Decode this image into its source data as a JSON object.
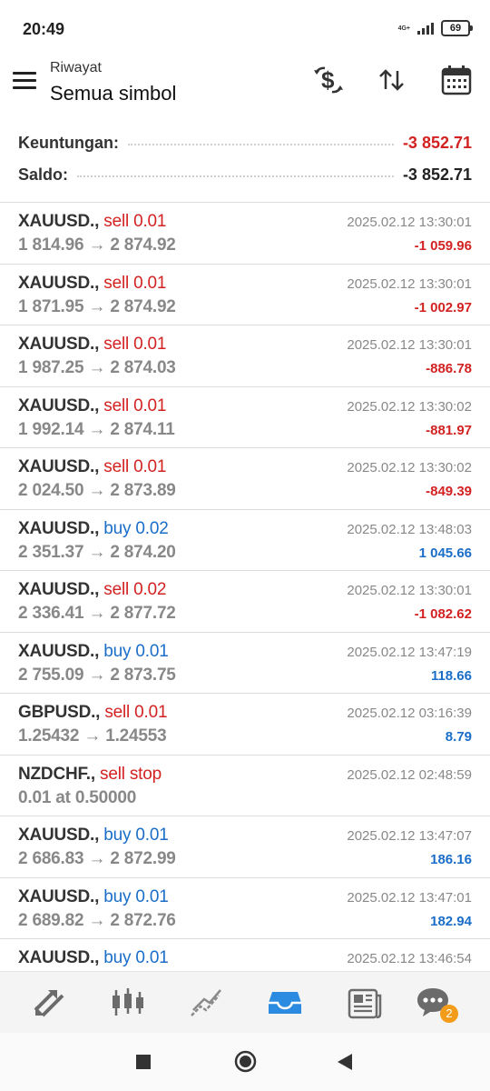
{
  "status_bar": {
    "time": "20:49",
    "network_top": "4G+",
    "network_bottom": "ıl",
    "battery": "69"
  },
  "app_bar": {
    "subtitle": "Riwayat",
    "title": "Semua simbol",
    "icons": [
      "menu-icon",
      "dollar-exchange-icon",
      "sort-icon",
      "calendar-icon"
    ]
  },
  "summary": {
    "profit_label": "Keuntungan:",
    "profit_value": "-3 852.71",
    "balance_label": "Saldo:",
    "balance_value": "-3 852.71"
  },
  "colors": {
    "sell": "#d32222",
    "buy": "#1a6ec8",
    "accent": "#2a8be0",
    "badge": "#f39c19"
  },
  "trades": [
    {
      "symbol": "XAUUSD.,",
      "action": "sell 0.01",
      "side": "sell",
      "prices": "1 814.96 → 2 874.92",
      "time": "2025.02.12 13:30:01",
      "profit": "-1 059.96",
      "profit_sign": "neg"
    },
    {
      "symbol": "XAUUSD.,",
      "action": "sell 0.01",
      "side": "sell",
      "prices": "1 871.95 → 2 874.92",
      "time": "2025.02.12 13:30:01",
      "profit": "-1 002.97",
      "profit_sign": "neg"
    },
    {
      "symbol": "XAUUSD.,",
      "action": "sell 0.01",
      "side": "sell",
      "prices": "1 987.25 → 2 874.03",
      "time": "2025.02.12 13:30:01",
      "profit": "-886.78",
      "profit_sign": "neg"
    },
    {
      "symbol": "XAUUSD.,",
      "action": "sell 0.01",
      "side": "sell",
      "prices": "1 992.14 → 2 874.11",
      "time": "2025.02.12 13:30:02",
      "profit": "-881.97",
      "profit_sign": "neg"
    },
    {
      "symbol": "XAUUSD.,",
      "action": "sell 0.01",
      "side": "sell",
      "prices": "2 024.50 → 2 873.89",
      "time": "2025.02.12 13:30:02",
      "profit": "-849.39",
      "profit_sign": "neg"
    },
    {
      "symbol": "XAUUSD.,",
      "action": "buy 0.02",
      "side": "buy",
      "prices": "2 351.37 → 2 874.20",
      "time": "2025.02.12 13:48:03",
      "profit": "1 045.66",
      "profit_sign": "pos"
    },
    {
      "symbol": "XAUUSD.,",
      "action": "sell 0.02",
      "side": "sell",
      "prices": "2 336.41 → 2 877.72",
      "time": "2025.02.12 13:30:01",
      "profit": "-1 082.62",
      "profit_sign": "neg"
    },
    {
      "symbol": "XAUUSD.,",
      "action": "buy 0.01",
      "side": "buy",
      "prices": "2 755.09 → 2 873.75",
      "time": "2025.02.12 13:47:19",
      "profit": "118.66",
      "profit_sign": "pos"
    },
    {
      "symbol": "GBPUSD.,",
      "action": "sell 0.01",
      "side": "sell",
      "prices": "1.25432 → 1.24553",
      "time": "2025.02.12 03:16:39",
      "profit": "8.79",
      "profit_sign": "pos"
    },
    {
      "symbol": "NZDCHF.,",
      "action": "sell stop",
      "side": "sell",
      "prices": "0.01 at 0.50000",
      "time": "2025.02.12 02:48:59",
      "profit": "",
      "profit_sign": "none"
    },
    {
      "symbol": "XAUUSD.,",
      "action": "buy 0.01",
      "side": "buy",
      "prices": "2 686.83 → 2 872.99",
      "time": "2025.02.12 13:47:07",
      "profit": "186.16",
      "profit_sign": "pos"
    },
    {
      "symbol": "XAUUSD.,",
      "action": "buy 0.01",
      "side": "buy",
      "prices": "2 689.82 → 2 872.76",
      "time": "2025.02.12 13:47:01",
      "profit": "182.94",
      "profit_sign": "pos"
    },
    {
      "symbol": "XAUUSD.,",
      "action": "buy 0.01",
      "side": "buy",
      "prices": "",
      "time": "2025.02.12 13:46:54",
      "profit": "",
      "profit_sign": "none"
    }
  ],
  "tab_bar": {
    "tabs": [
      "quotes-icon",
      "chart-icon",
      "trade-icon",
      "history-icon",
      "news-icon",
      "chat-icon"
    ],
    "active": "history-icon",
    "chat_badge": "2"
  },
  "nav_bar": [
    "recent-apps-icon",
    "home-icon",
    "back-icon"
  ]
}
